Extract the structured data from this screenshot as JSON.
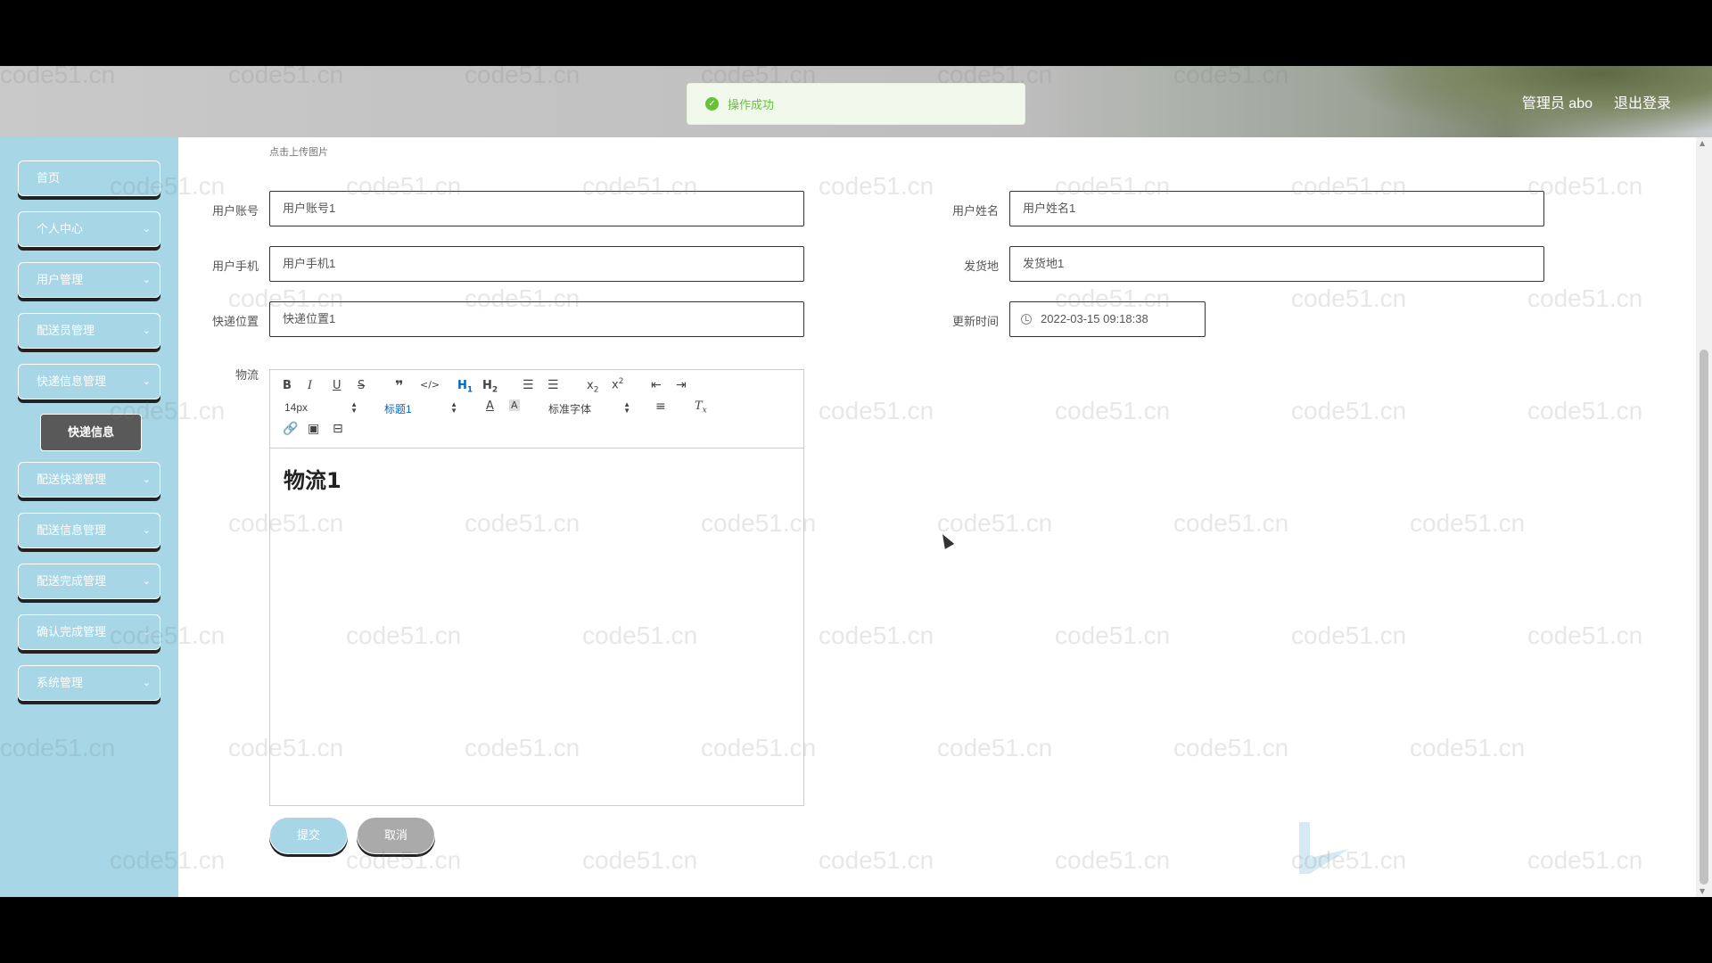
{
  "header": {
    "admin_label": "管理员 abo",
    "logout_label": "退出登录"
  },
  "toast": {
    "message": "操作成功"
  },
  "sidebar": {
    "items": [
      {
        "label": "首页",
        "has_chevron": false
      },
      {
        "label": "个人中心",
        "has_chevron": true
      },
      {
        "label": "用户管理",
        "has_chevron": true
      },
      {
        "label": "配送员管理",
        "has_chevron": true
      },
      {
        "label": "快递信息管理",
        "has_chevron": true
      },
      {
        "label": "配送快递管理",
        "has_chevron": true
      },
      {
        "label": "配送信息管理",
        "has_chevron": true
      },
      {
        "label": "配送完成管理",
        "has_chevron": true
      },
      {
        "label": "确认完成管理",
        "has_chevron": true
      },
      {
        "label": "系统管理",
        "has_chevron": true
      }
    ],
    "sub_item": "快递信息"
  },
  "form": {
    "upload_hint": "点击上传图片",
    "fields": {
      "account": {
        "label": "用户账号",
        "value": "用户账号1"
      },
      "name": {
        "label": "用户姓名",
        "value": "用户姓名1"
      },
      "phone": {
        "label": "用户手机",
        "value": "用户手机1"
      },
      "origin": {
        "label": "发货地",
        "value": "发货地1"
      },
      "location": {
        "label": "快递位置",
        "value": "快递位置1"
      },
      "updated": {
        "label": "更新时间",
        "value": "2022-03-15 09:18:38"
      },
      "logistics": {
        "label": "物流"
      }
    },
    "editor": {
      "font_size": "14px",
      "heading": "标题1",
      "font_family": "标准字体",
      "content": "物流1"
    },
    "submit_label": "提交",
    "cancel_label": "取消"
  },
  "watermark": "code51.cn"
}
